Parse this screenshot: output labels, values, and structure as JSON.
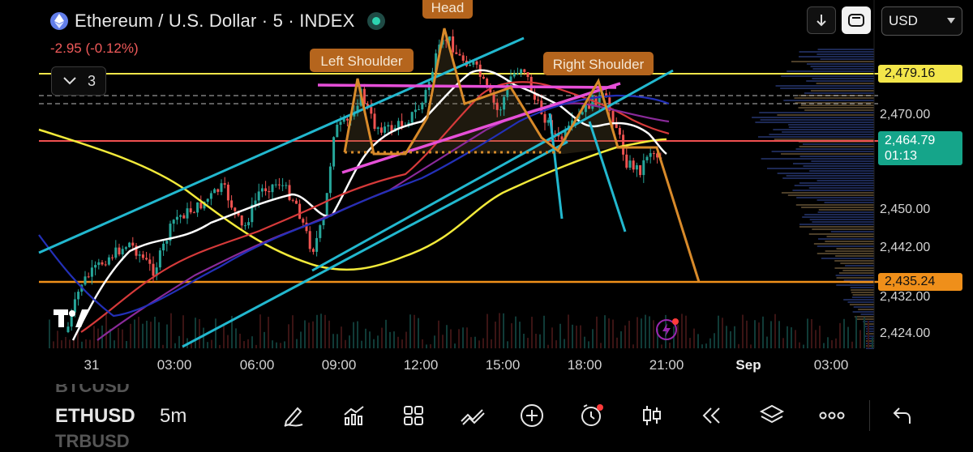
{
  "header": {
    "title": "Ethereum / U.S. Dollar · 5 · INDEX",
    "change": "-2.95 (-0.12%)",
    "indicator_count": "3"
  },
  "controls": {
    "currency": "USD"
  },
  "price_axis": {
    "ticks": [
      "2,470.00",
      "2,450.00",
      "2,442.00",
      "2,432.00",
      "2,424.00"
    ],
    "resistance": "2,479.16",
    "last_price": "2,464.79",
    "countdown": "01:13",
    "target": "2,435.24"
  },
  "time_axis": [
    "31",
    "03:00",
    "06:00",
    "09:00",
    "12:00",
    "15:00",
    "18:00",
    "21:00",
    "Sep",
    "03:00"
  ],
  "annotations": {
    "left_shoulder": "Left Shoulder",
    "head": "Head",
    "right_shoulder": "Right Shoulder"
  },
  "colors": {
    "background": "#000000",
    "bull": "#26a69a",
    "bear": "#ef5350",
    "resistance_line": "#f3e64a",
    "target_line": "#ef8f1a",
    "channel": "#22b8cf",
    "neckline": "#e64fd8",
    "annotation_bg": "#b5651d"
  },
  "toolbar": {
    "symbols_ghost_above": "BTCUSD",
    "symbol": "ETHUSD",
    "symbols_ghost_below": "TRBUSD",
    "timeframe": "5m",
    "icons": [
      "pencil-icon",
      "indicators-icon",
      "layouts-icon",
      "drawings-icon",
      "add-icon",
      "alert-icon",
      "candles-icon",
      "replay-icon",
      "layers-icon",
      "more-icon",
      "undo-icon"
    ]
  },
  "chart_data": {
    "type": "candlestick",
    "symbol": "ETHUSD",
    "interval": "5m",
    "ylim": [
      2420,
      2486
    ],
    "x": [
      "31",
      "03:00",
      "06:00",
      "09:00",
      "12:00",
      "15:00",
      "18:00",
      "21:00"
    ],
    "levels": [
      2479.16,
      2464.79,
      2435.24
    ],
    "series": [
      {
        "values": [
          2440,
          2446,
          2452,
          2456,
          2468,
          2476,
          2483,
          2478,
          2473,
          2476,
          2468,
          2462
        ]
      }
    ]
  }
}
